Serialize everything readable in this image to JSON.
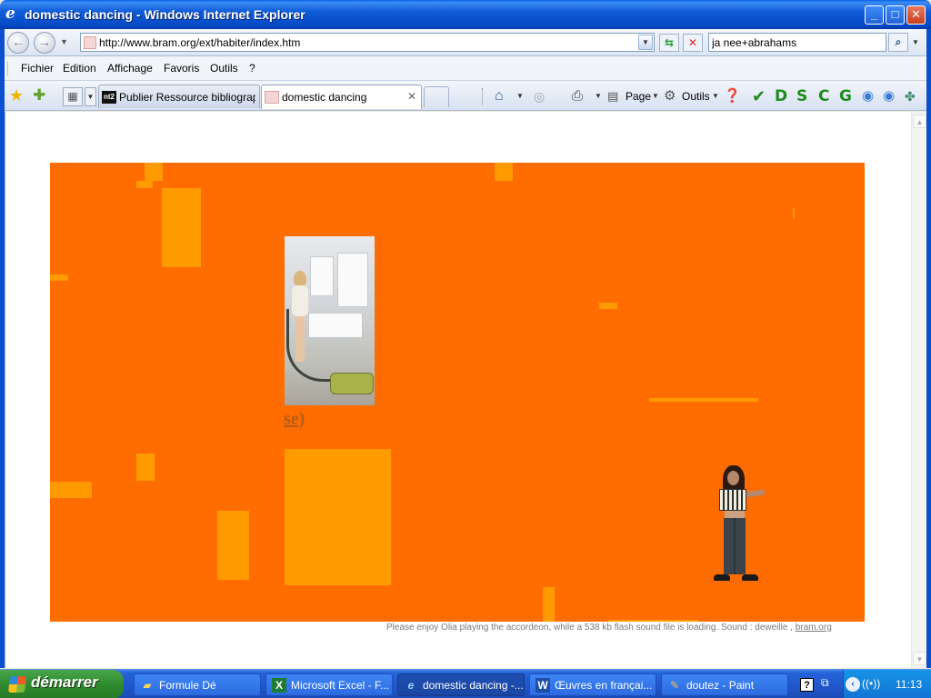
{
  "window": {
    "title": "domestic dancing - Windows Internet Explorer",
    "minimize": "_",
    "maximize": "□",
    "close": "✕"
  },
  "address": {
    "url": "http://www.bram.org/ext/habiter/index.htm",
    "search_value": "ja nee+abrahams"
  },
  "menu": {
    "items": [
      "Fichier",
      "Edition",
      "Affichage",
      "Favoris",
      "Outils",
      "?"
    ]
  },
  "tabs": [
    {
      "label": "Publier Ressource bibliograph...",
      "favicon": "nt2"
    },
    {
      "label": "domestic dancing",
      "close": "✕"
    }
  ],
  "commands": {
    "page_label": "Page",
    "tools_label": "Outils",
    "letters": [
      "D",
      "S",
      "C",
      "G"
    ]
  },
  "content": {
    "caption_fragment": "se)",
    "loading_note": "Please enjoy Olia playing the accordeon, while a 538 kb flash sound file is loading. Sound : deweille ,",
    "link_text": "bram.org"
  },
  "taskbar": {
    "start_label": "démarrer",
    "tasks": [
      {
        "label": "Formule Dé",
        "icon": "folder-icon"
      },
      {
        "label": "Microsoft Excel - F...",
        "icon": "excel-icon"
      },
      {
        "label": "domestic dancing -...",
        "icon": "ie-icon"
      },
      {
        "label": "Œuvres en françai...",
        "icon": "word-icon"
      },
      {
        "label": "doutez - Paint",
        "icon": "paint-icon"
      }
    ],
    "clock": "11:13"
  },
  "colors": {
    "stage_bg": "#ff6c00",
    "stage_block": "#ff9a00",
    "titlebar": "#0a5fe6"
  }
}
